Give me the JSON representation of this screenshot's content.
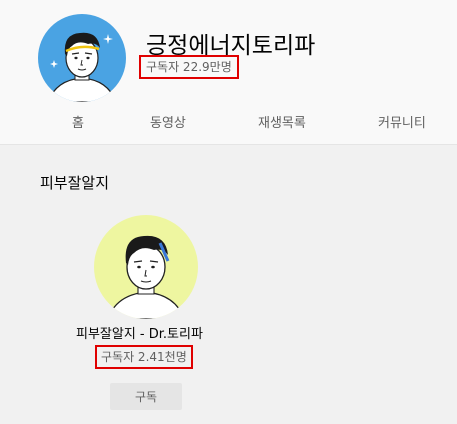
{
  "channel": {
    "name": "긍정에너지토리파",
    "subscribers": "구독자 22.9만명",
    "avatar_bg": "#4aa3e3"
  },
  "tabs": [
    {
      "label": "홈"
    },
    {
      "label": "동영상"
    },
    {
      "label": "재생목록"
    },
    {
      "label": "커뮤니티"
    }
  ],
  "section": {
    "title": "피부잘알지"
  },
  "featured_channel": {
    "name": "피부잘알지 - Dr.토리파",
    "subscribers": "구독자 2.41천명",
    "subscribe_label": "구독",
    "avatar_bg": "#eef6a0"
  },
  "colors": {
    "highlight_border": "#e00000",
    "header_bg": "#f9f9f9",
    "page_bg": "#f1f1f1"
  }
}
